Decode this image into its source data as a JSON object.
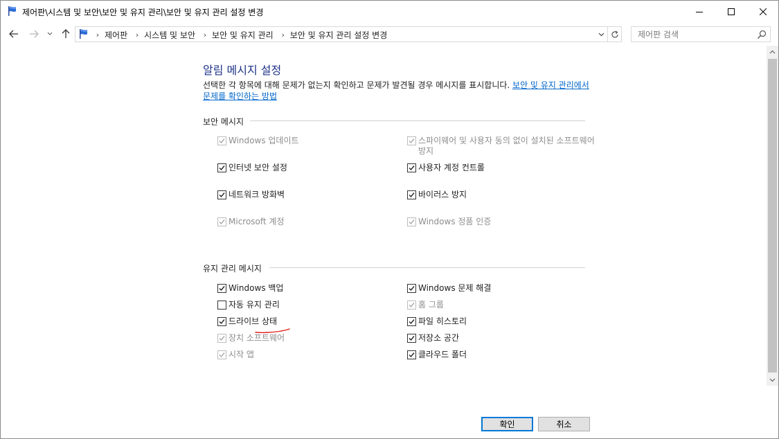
{
  "window": {
    "title": "제어판\\시스템 및 보안\\보안 및 유지 관리\\보안 및 유지 관리 설정 변경"
  },
  "addressbar": {
    "crumbs": [
      "제어판",
      "시스템 및 보안",
      "보안 및 유지 관리",
      "보안 및 유지 관리 설정 변경"
    ]
  },
  "search": {
    "placeholder": "제어판 검색"
  },
  "main": {
    "heading": "알림 메시지 설정",
    "description": "선택한 각 항목에 대해 문제가 없는지 확인하고 문제가 발견될 경우 메시지를 표시합니다. ",
    "link_text": "보안 및 유지 관리에서 문제를 확인하는 방법"
  },
  "security": {
    "title": "보안 메시지",
    "items": [
      {
        "label": "Windows 업데이트",
        "checked": true,
        "enabled": false
      },
      {
        "label": "스파이웨어 및 사용자 동의 없이 설치된 소프트웨어 방지",
        "checked": true,
        "enabled": false
      },
      {
        "label": "인터넷 보안 설정",
        "checked": true,
        "enabled": true
      },
      {
        "label": "사용자 계정 컨트롤",
        "checked": true,
        "enabled": true
      },
      {
        "label": "네트워크 방화벽",
        "checked": true,
        "enabled": true
      },
      {
        "label": "바이러스 방지",
        "checked": true,
        "enabled": true
      },
      {
        "label": "Microsoft 계정",
        "checked": true,
        "enabled": false
      },
      {
        "label": "Windows 정품 인증",
        "checked": true,
        "enabled": false
      }
    ]
  },
  "maintenance": {
    "title": "유지 관리 메시지",
    "items": [
      {
        "label": "Windows 백업",
        "checked": true,
        "enabled": true
      },
      {
        "label": "Windows 문제 해결",
        "checked": true,
        "enabled": true
      },
      {
        "label": "자동 유지 관리",
        "checked": false,
        "enabled": true
      },
      {
        "label": "홈 그룹",
        "checked": true,
        "enabled": false
      },
      {
        "label": "드라이브 상태",
        "checked": true,
        "enabled": true
      },
      {
        "label": "파일 히스토리",
        "checked": true,
        "enabled": true
      },
      {
        "label": "장치 소프트웨어",
        "checked": true,
        "enabled": false
      },
      {
        "label": "저장소 공간",
        "checked": true,
        "enabled": true
      },
      {
        "label": "시작 앱",
        "checked": true,
        "enabled": false
      },
      {
        "label": "클라우드 폴더",
        "checked": true,
        "enabled": true
      }
    ]
  },
  "footer": {
    "ok_label": "확인",
    "cancel_label": "취소"
  },
  "colors": {
    "heading": "#1e3287",
    "link": "#0066cc",
    "primary_border": "#0078d7",
    "annotation": "#e0201b"
  }
}
